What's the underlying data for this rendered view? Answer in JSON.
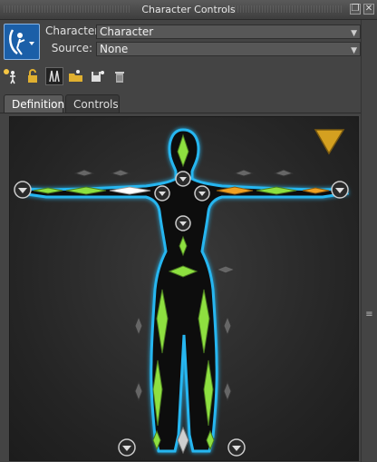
{
  "window": {
    "title": "Character Controls"
  },
  "colors": {
    "accent_green": "#7dd63a",
    "accent_orange": "#f0a020",
    "glow_blue": "#26b6f0",
    "panel": "#444444"
  },
  "source_panel": {
    "character_label": "Character:",
    "character_value": "Character",
    "source_label": "Source:",
    "source_value": "None"
  },
  "toolbar": {
    "icons": [
      "create-character-icon",
      "lock-icon",
      "mirror-icon",
      "open-folder-icon",
      "save-icon",
      "trash-icon"
    ]
  },
  "tabs": [
    {
      "label": "Definition",
      "active": true
    },
    {
      "label": "Controls",
      "active": false
    }
  ]
}
